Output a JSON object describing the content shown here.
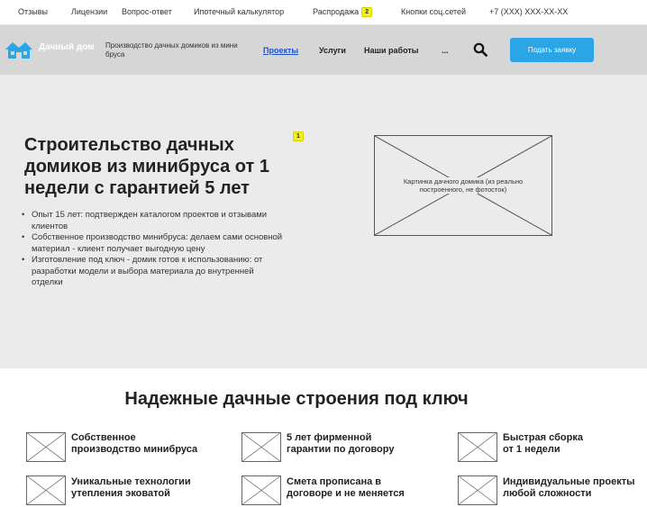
{
  "topbar": {
    "links": [
      {
        "label": "Отзывы"
      },
      {
        "label": "Лицензии"
      },
      {
        "label": "Вопрос-ответ"
      },
      {
        "label": "Ипотечный калькулятор"
      },
      {
        "label": "Распродажа",
        "badge": "2"
      },
      {
        "label": "Кнопки соц.сетей"
      },
      {
        "label": "+7 (XXX) XXX-XX-XX"
      }
    ]
  },
  "header": {
    "logo_text": "Дачный дом",
    "tagline": "Производство дачных домиков из мини бруса",
    "nav": [
      "Проекты",
      "Услуги",
      "Наши работы",
      "..."
    ],
    "cta_label": "Подать заявку"
  },
  "hero": {
    "title": "Строительство дачных домиков из минибруса от 1 недели с гарантией 5 лет",
    "badge": "1",
    "bullets": [
      "Опыт 15 лет: подтвержден каталогом проектов и отзывами клиентов",
      "Собственное производство минибруса: делаем сами основной материал - клиент получает выгодную цену",
      "Изготовление под ключ - домик готов к использованию: от разработки модели и выбора материала до внутренней отделки"
    ],
    "image_caption": "Картинка дачного домика (из реально построенного, не фотосток)"
  },
  "features": {
    "title": "Надежные дачные строения под ключ",
    "items": [
      [
        "Собственное",
        "производство минибруса"
      ],
      [
        "5 лет фирменной",
        "гарантии по договору"
      ],
      [
        "Быстрая сборка",
        "от 1 недели"
      ],
      [
        "Уникальные технологии",
        "утепления эковатой"
      ],
      [
        "Смета прописана в",
        "договоре и не меняется"
      ],
      [
        "Индивидуальные проекты",
        "любой сложности"
      ]
    ]
  },
  "colors": {
    "accent": "#2aa5e5",
    "header_bg": "#d6d6d6",
    "hero_bg": "#ebebeb",
    "badge": "#f3ef1f",
    "active_link": "#1d4fd6"
  }
}
